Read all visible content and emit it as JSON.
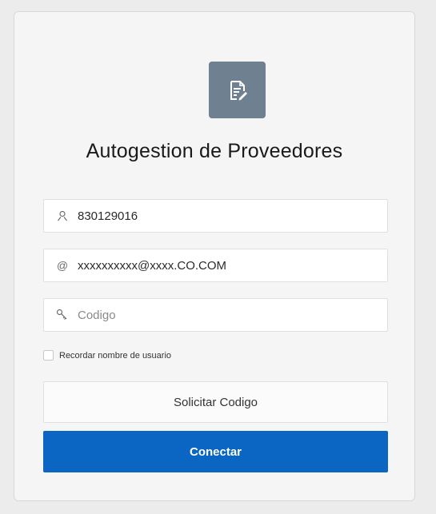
{
  "login": {
    "title": "Autogestion de Proveedores",
    "username": {
      "value": "830129016",
      "icon": "user-icon"
    },
    "email": {
      "value": "xxxxxxxxxx@xxxx.CO.COM",
      "icon": "at-icon"
    },
    "code": {
      "placeholder": "Codigo",
      "value": "",
      "icon": "key-icon"
    },
    "remember_label": "Recordar nombre de usuario",
    "remember_checked": false,
    "request_code_label": "Solicitar Codigo",
    "connect_label": "Conectar"
  },
  "colors": {
    "primary": "#0b66c3",
    "logo_bg": "#6f8090",
    "card_bg": "#f5f5f5"
  }
}
